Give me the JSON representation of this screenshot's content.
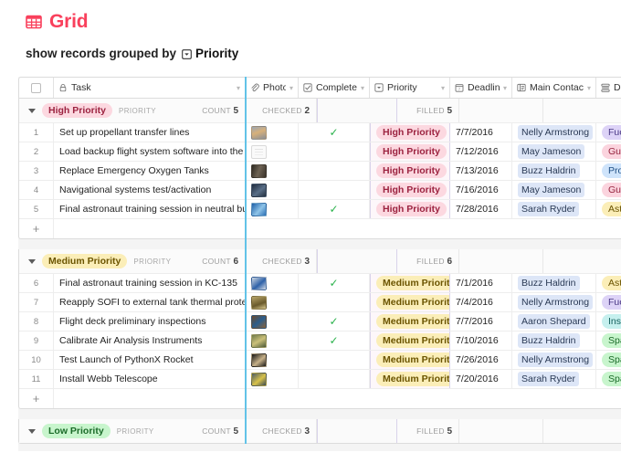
{
  "header": {
    "brand_title": "Grid",
    "brand_icon": "grid-icon",
    "subtitle_text": "show records grouped by",
    "group_field": "Priority",
    "group_field_icon": "single-select-icon"
  },
  "columns": [
    {
      "key": "check",
      "label": "",
      "icon": "header-checkbox",
      "caret": false
    },
    {
      "key": "task",
      "label": "Task",
      "icon": "lock-icon",
      "caret": true
    },
    {
      "key": "photo",
      "label": "Photo(s)",
      "icon": "attachment-icon",
      "caret": true
    },
    {
      "key": "complete",
      "label": "Complete?",
      "icon": "checkbox-icon",
      "caret": true
    },
    {
      "key": "priority",
      "label": "Priority",
      "icon": "single-select-icon",
      "caret": true
    },
    {
      "key": "deadline",
      "label": "Deadline",
      "icon": "calendar-icon",
      "caret": true
    },
    {
      "key": "contact",
      "label": "Main Contact",
      "icon": "link-record-icon",
      "caret": true
    },
    {
      "key": "dept",
      "label": "Depar",
      "icon": "multi-select-icon",
      "caret": false
    }
  ],
  "colors": {
    "brand": "#f9405c",
    "check_green": "#2bb24c",
    "frozen_divider": "#62c3e8",
    "priority_divider": "#d9d3ea",
    "chip_high_bg": "#fcd8e0",
    "chip_high_fg": "#9c2340",
    "chip_medium_bg": "#fbeeb8",
    "chip_medium_fg": "#6b5400",
    "chip_low_bg": "#c8f5cd",
    "chip_low_fg": "#1b6b29",
    "chip_contact_bg": "#dde6f7",
    "chip_contact_fg": "#2a3a55"
  },
  "groups": [
    {
      "name": "High Priority",
      "chip_style": "high",
      "field_name": "PRIORITY",
      "aggregates": {
        "count_label": "COUNT",
        "count_value": "5",
        "checked_label": "CHECKED",
        "checked_value": "2",
        "filled_label": "FILLED",
        "filled_value": "5"
      },
      "collapsed": false,
      "rows": [
        {
          "num": "1",
          "task": "Set up propellant transfer lines",
          "photo": "photo-astronaut-suit",
          "complete": true,
          "priority": "High Priority",
          "deadline": "7/7/2016",
          "contact": "Nelly Armstrong",
          "dept": "Fueling",
          "dept_style": "purple"
        },
        {
          "num": "2",
          "task": "Load backup flight system software into the orbiter",
          "photo": "document-thumbnail",
          "complete": false,
          "priority": "High Priority",
          "deadline": "7/12/2016",
          "contact": "May Jameson",
          "dept": "Guidanc",
          "dept_style": "pink"
        },
        {
          "num": "3",
          "task": "Replace Emergency Oxygen Tanks",
          "photo": "photo-oxygen-tanks",
          "complete": false,
          "priority": "High Priority",
          "deadline": "7/13/2016",
          "contact": "Buzz Haldrin",
          "dept": "Procure",
          "dept_style": "blue"
        },
        {
          "num": "4",
          "task": "Navigational systems test/activation",
          "photo": "photo-control-panel",
          "complete": false,
          "priority": "High Priority",
          "deadline": "7/16/2016",
          "contact": "May Jameson",
          "dept": "Guidanc",
          "dept_style": "pink"
        },
        {
          "num": "5",
          "task": "Final astronaut training session in neutral buoyan…",
          "photo": "photo-underwater",
          "complete": true,
          "priority": "High Priority",
          "deadline": "7/28/2016",
          "contact": "Sarah Ryder",
          "dept": "Astrona",
          "dept_style": "yellow"
        }
      ],
      "add_row_label": "+"
    },
    {
      "name": "Medium Priority",
      "chip_style": "medium",
      "field_name": "PRIORITY",
      "aggregates": {
        "count_label": "COUNT",
        "count_value": "6",
        "checked_label": "CHECKED",
        "checked_value": "3",
        "filled_label": "FILLED",
        "filled_value": "6"
      },
      "collapsed": false,
      "rows": [
        {
          "num": "6",
          "task": "Final astronaut training session in KC-135",
          "photo": "photo-zero-g",
          "complete": true,
          "priority": "Medium Priority",
          "deadline": "7/1/2016",
          "contact": "Buzz Haldrin",
          "dept": "Astrona",
          "dept_style": "yellow"
        },
        {
          "num": "7",
          "task": "Reapply SOFI to external tank thermal protection…",
          "photo": "photo-tank",
          "complete": false,
          "priority": "Medium Priority",
          "deadline": "7/4/2016",
          "contact": "Nelly Armstrong",
          "dept": "Fueling",
          "dept_style": "purple"
        },
        {
          "num": "8",
          "task": "Flight deck preliminary inspections",
          "photo": "photo-flight-deck",
          "complete": true,
          "priority": "Medium Priority",
          "deadline": "7/7/2016",
          "contact": "Aaron Shepard",
          "dept": "Inspecti",
          "dept_style": "cyan"
        },
        {
          "num": "9",
          "task": "Calibrate Air Analysis Instruments",
          "photo": "photo-instruments",
          "complete": true,
          "priority": "Medium Priority",
          "deadline": "7/10/2016",
          "contact": "Buzz Haldrin",
          "dept": "Space T",
          "dept_style": "green"
        },
        {
          "num": "10",
          "task": "Test Launch of PythonX Rocket",
          "photo": "photo-rocket-launch",
          "complete": false,
          "priority": "Medium Priority",
          "deadline": "7/26/2016",
          "contact": "Nelly Armstrong",
          "dept": "Space T",
          "dept_style": "green"
        },
        {
          "num": "11",
          "task": "Install Webb Telescope",
          "photo": "photo-telescope",
          "complete": false,
          "priority": "Medium Priority",
          "deadline": "7/20/2016",
          "contact": "Sarah Ryder",
          "dept": "Space T",
          "dept_style": "green"
        }
      ],
      "add_row_label": "+"
    },
    {
      "name": "Low Priority",
      "chip_style": "low",
      "field_name": "PRIORITY",
      "aggregates": {
        "count_label": "COUNT",
        "count_value": "5",
        "checked_label": "CHECKED",
        "checked_value": "3",
        "filled_label": "FILLED",
        "filled_value": "5"
      },
      "collapsed": true,
      "rows": [],
      "add_row_label": "+"
    }
  ]
}
